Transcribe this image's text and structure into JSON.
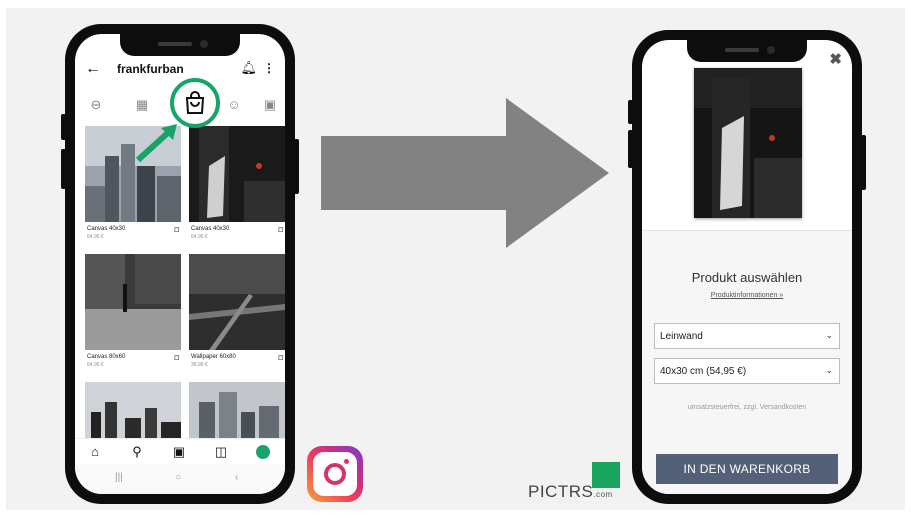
{
  "instagram_screen": {
    "username": "frankfurban",
    "back_icon": "arrow-left-icon",
    "tabs": [
      "grid-icon",
      "reels-icon",
      "shop-bag-icon",
      "tagged-icon",
      "profile-tag-icon"
    ],
    "posts": [
      {
        "title": "Canvas 40x30",
        "price": "54,95 €"
      },
      {
        "title": "Canvas 40x30",
        "price": "54,95 €"
      },
      {
        "title": "Canvas 80x60",
        "price": "54,95 €"
      },
      {
        "title": "Wallpaper 60x80",
        "price": "39,99 €"
      }
    ],
    "bottom_nav": [
      "home-icon",
      "search-icon",
      "reels-icon",
      "shop-icon",
      "profile-icon"
    ]
  },
  "pictrs_screen": {
    "heading": "Produkt auswählen",
    "info_link": "Produktinformationen »",
    "material_select": "Leinwand",
    "size_select": "40x30 cm (54,95 €)",
    "tax_note": "umsatzsteuerfrei, zzgl. Versandkosten",
    "cart_button": "IN DEN WARENKORB"
  },
  "logos": {
    "pictrs_name": "PICTRS",
    "pictrs_domain": ".com"
  },
  "colors": {
    "highlight_green": "#18a36b",
    "cart_button": "#546077",
    "arrow_gray": "#828282"
  }
}
